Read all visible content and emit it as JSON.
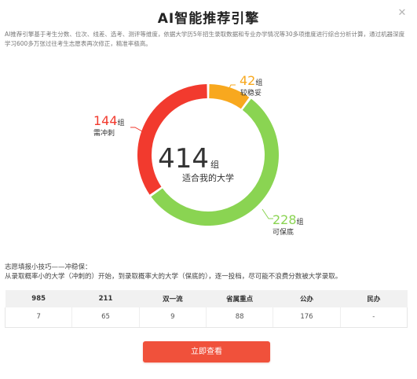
{
  "modal": {
    "title": "AI智能推荐引擎",
    "close_icon": "close-icon",
    "description": "AI推荐引擎基于考生分数、位次、线差、选考、测评等维度，依据大学历5年招生录取数据和专业办学情况等30多项维度进行综合分析计算，通过机器深度学习600多万张过往考生志愿表再次修正，精准率极高。"
  },
  "colors": {
    "red": "#f23a2e",
    "orange": "#f8a81e",
    "green": "#8ad452",
    "button": "#f0513b"
  },
  "chart_data": {
    "type": "pie",
    "total": {
      "value": "414",
      "unit": "组",
      "label": "适合我的大学"
    },
    "slices": [
      {
        "value": 42,
        "unit": "组",
        "label": "较稳妥",
        "color": "#f8a81e"
      },
      {
        "value": 228,
        "unit": "组",
        "label": "可保底",
        "color": "#8ad452"
      },
      {
        "value": 144,
        "unit": "组",
        "label": "需冲刺",
        "color": "#f23a2e"
      }
    ]
  },
  "tips": {
    "title": "志愿填报小技巧——冲稳保：",
    "body": "从录取概率小的大学（冲刺的）开始，到录取概率大的大学（保底的），逐一投档，尽可能不浪费分数被大学录取。"
  },
  "table": {
    "headers": [
      "985",
      "211",
      "双一流",
      "省属重点",
      "公办",
      "民办"
    ],
    "values": [
      "7",
      "65",
      "9",
      "88",
      "176",
      "-"
    ]
  },
  "cta": {
    "label": "立即查看"
  }
}
